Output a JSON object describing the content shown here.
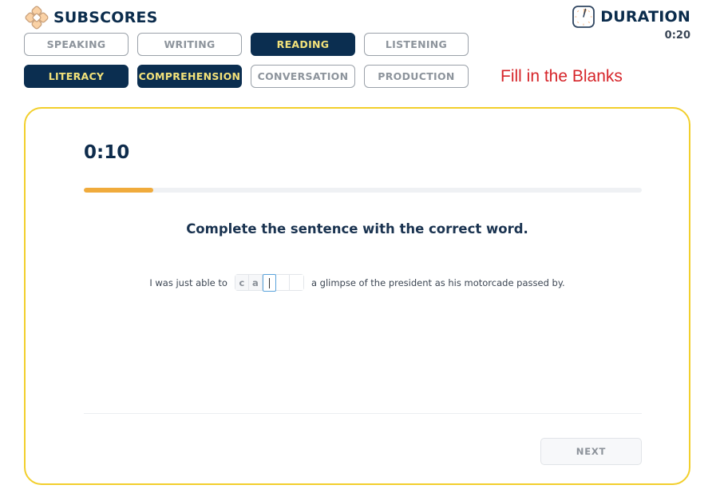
{
  "header": {
    "subscores_title": "SUBSCORES",
    "subscores_icon": "diamond-grid-icon",
    "duration_title": "DURATION",
    "duration_icon": "timer-clock-icon",
    "duration_value": "0:20"
  },
  "skills_row": [
    {
      "label": "SPEAKING",
      "selected": false
    },
    {
      "label": "WRITING",
      "selected": false
    },
    {
      "label": "READING",
      "selected": true
    },
    {
      "label": "LISTENING",
      "selected": false
    }
  ],
  "subskills_row": [
    {
      "label": "LITERACY",
      "selected": true
    },
    {
      "label": "COMPREHENSION",
      "selected": true
    },
    {
      "label": "CONVERSATION",
      "selected": false
    },
    {
      "label": "PRODUCTION",
      "selected": false
    }
  ],
  "task_label": "Fill in the Blanks",
  "colors": {
    "navy": "#0b2e50",
    "selected_text": "#f3e27a",
    "card_border": "#f2cf2c",
    "progress": "#f0ab3c",
    "task_label": "#d6252a",
    "active_cell": "#5aa3dc"
  },
  "card": {
    "timer": "0:10",
    "progress_fraction": 0.125,
    "prompt": "Complete the sentence with the correct word.",
    "sentence_before": "I was just able to",
    "sentence_after": "a glimpse of the president as his motorcade passed by.",
    "blank_cells": [
      {
        "value": "c",
        "state": "prefilled"
      },
      {
        "value": "a",
        "state": "prefilled"
      },
      {
        "value": "",
        "state": "active"
      },
      {
        "value": "",
        "state": "empty"
      },
      {
        "value": "",
        "state": "empty"
      }
    ],
    "next_label": "NEXT"
  }
}
